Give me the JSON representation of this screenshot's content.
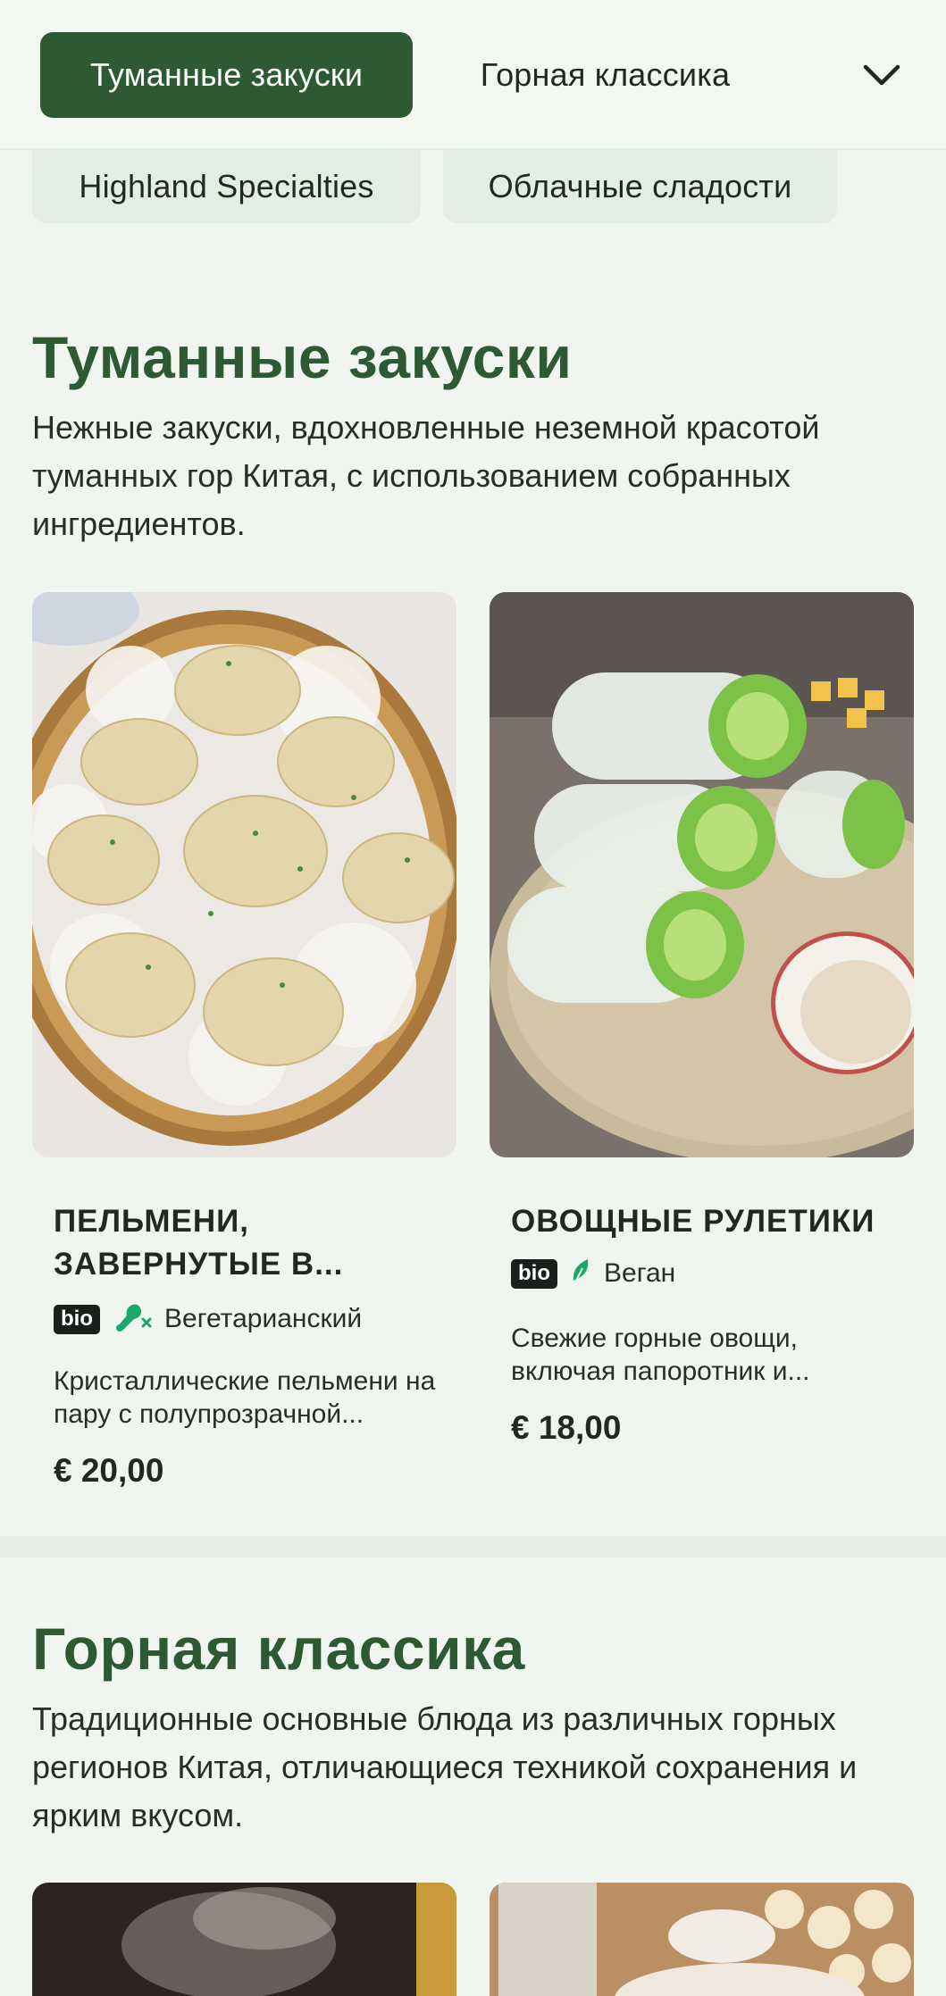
{
  "nav": {
    "tabs": [
      "Туманные закуски",
      "Горная классика",
      "Highland Specialties",
      "Облачные сладости"
    ],
    "active_tab": "Туманные закуски",
    "expand_icon": "chevron-down-icon"
  },
  "sections": [
    {
      "title": "Туманные закуски",
      "description": "Нежные закуски, вдохновленные неземной красотой туманных гор Китая, с использованием собранных ингредиентов.",
      "items": [
        {
          "name": "ПЕЛЬМЕНИ, ЗАВЕРНУТЫЕ В...",
          "badge": "bio",
          "diet_icon": "vegetarian-icon",
          "diet": "Вегетарианский",
          "description": "Кристаллические пельмени на пару с полупрозрачной...",
          "price": "€ 20,00"
        },
        {
          "name": "ОВОЩНЫЕ РУЛЕТИКИ",
          "badge": "bio",
          "diet_icon": "vegan-leaf-icon",
          "diet": "Веган",
          "description": "Свежие горные овощи, включая папоротник и...",
          "price": "€ 18,00"
        }
      ]
    },
    {
      "title": "Горная классика",
      "description": "Традиционные основные блюда из различных горных регионов Китая, отличающиеся техникой сохранения и ярким вкусом."
    }
  ],
  "colors": {
    "brand_green": "#2d5a32",
    "page_bg": "#f0f6ef",
    "diet_icon_green": "#1aa86a"
  }
}
